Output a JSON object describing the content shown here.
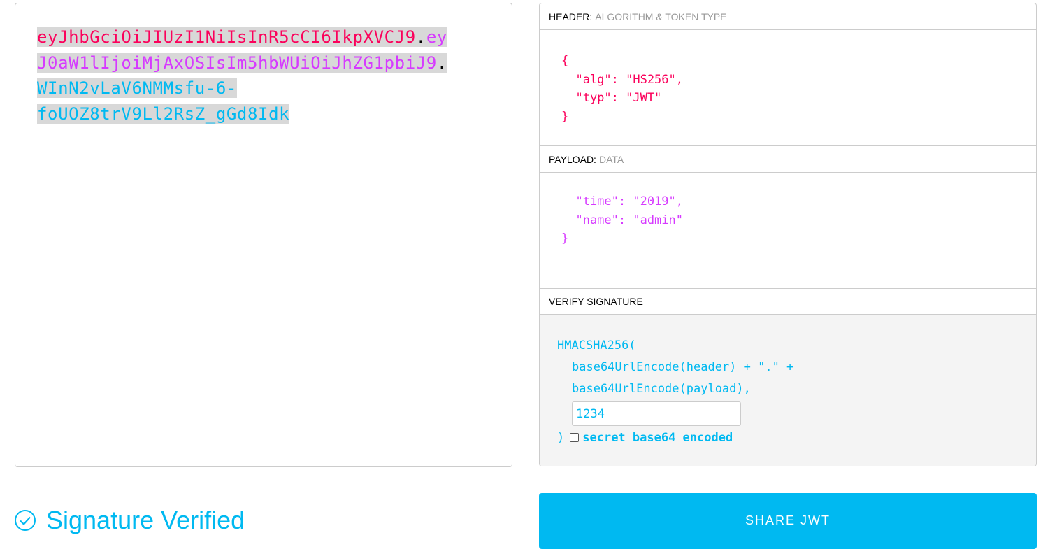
{
  "encoded": {
    "lines": [
      [
        {
          "t": "eyJhbGciOiJIUzI1NiIsInR5cCI6IkpXVCJ9",
          "c": "r"
        },
        {
          "t": ".",
          "c": "d"
        },
        {
          "t": "ey",
          "c": "p"
        }
      ],
      [
        {
          "t": "J0aW1lIjoiMjAxOSIsIm5hbWUiOiJhZG1pbiJ9",
          "c": "p"
        },
        {
          "t": ".",
          "c": "d"
        }
      ],
      [
        {
          "t": "WInN2vLaV6NMMsfu-6-",
          "c": "c"
        }
      ],
      [
        {
          "t": "foUOZ8trV9Ll2RsZ_gGd8Idk",
          "c": "c"
        }
      ]
    ]
  },
  "header": {
    "label": "HEADER:",
    "sub": "ALGORITHM & TOKEN TYPE",
    "lines": [
      "{",
      "  \"alg\": \"HS256\",",
      "  \"typ\": \"JWT\"",
      "}"
    ]
  },
  "payload": {
    "label": "PAYLOAD:",
    "sub": "DATA",
    "lines": [
      "  \"time\": \"2019\",",
      "  \"name\": \"admin\"",
      "}"
    ]
  },
  "verify": {
    "label": "VERIFY SIGNATURE",
    "fn": "HMACSHA256(",
    "l1": "base64UrlEncode(header) + \".\" +",
    "l2": "base64UrlEncode(payload),",
    "secret": "1234",
    "close": ")",
    "checkbox_label": "secret base64 encoded",
    "checked": false
  },
  "status": "Signature Verified",
  "share_label": "SHARE JWT",
  "colors": {
    "header": "#fb015b",
    "payload": "#d63aff",
    "signature": "#00b9f1"
  }
}
